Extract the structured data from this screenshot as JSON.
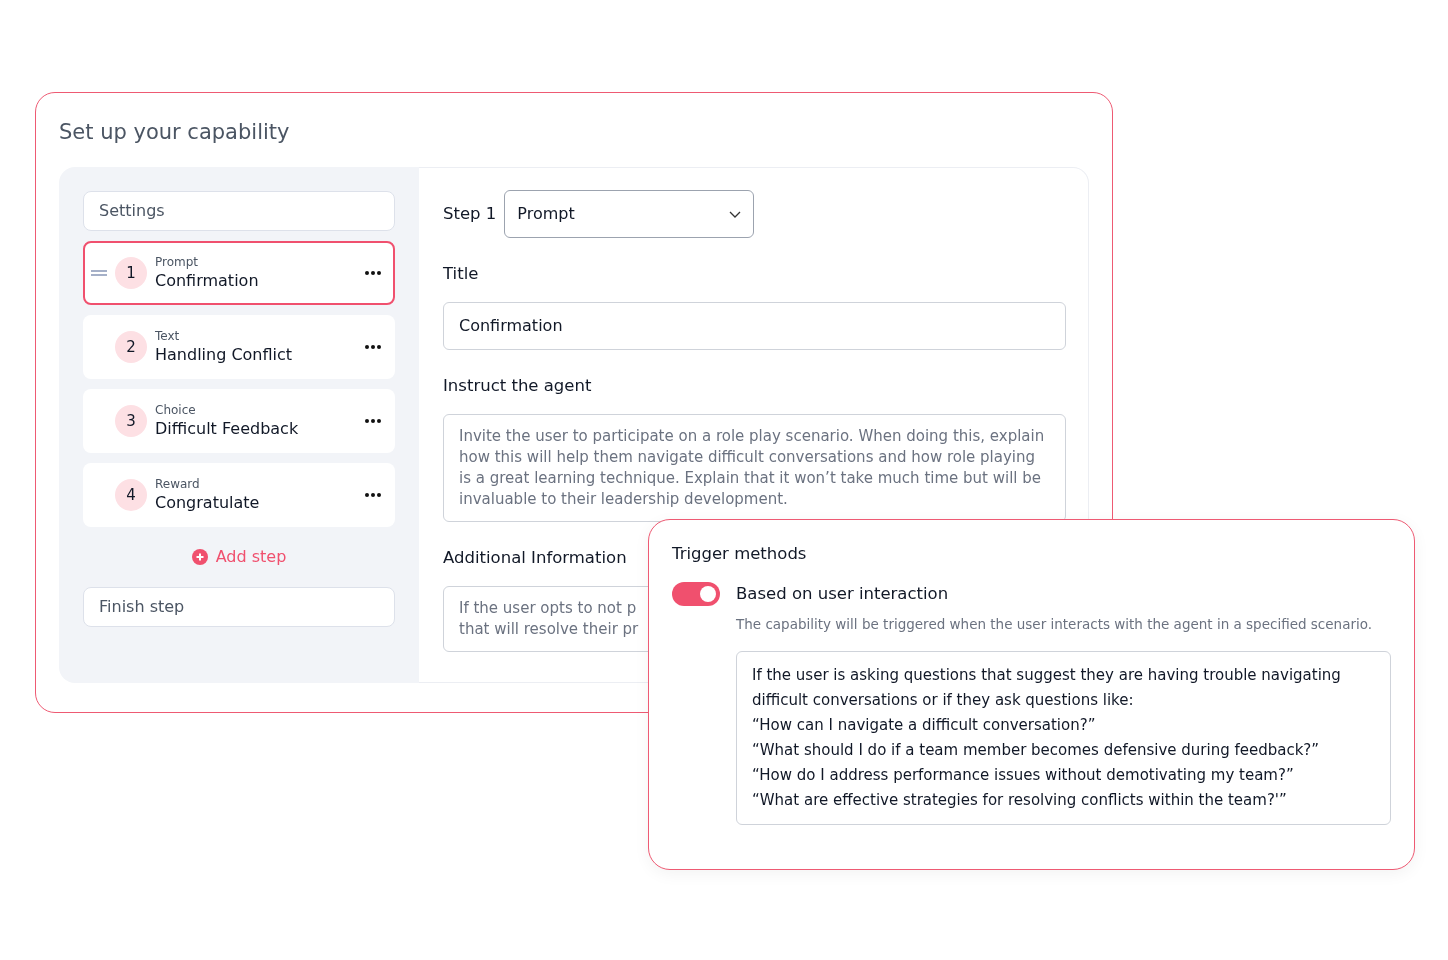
{
  "heading": "Set up your capability",
  "sidebar": {
    "settings": "Settings",
    "steps": [
      {
        "number": "1",
        "type": "Prompt",
        "title": "Confirmation",
        "selected": true
      },
      {
        "number": "2",
        "type": "Text",
        "title": "Handling Conflict",
        "selected": false
      },
      {
        "number": "3",
        "type": "Choice",
        "title": "Difficult Feedback",
        "selected": false
      },
      {
        "number": "4",
        "type": "Reward",
        "title": "Congratulate",
        "selected": false
      }
    ],
    "add_step": "Add step",
    "finish": "Finish step"
  },
  "editor": {
    "step_label": "Step 1",
    "step_type": "Prompt",
    "title_label": "Title",
    "title_value": "Confirmation",
    "instruct_label": "Instruct the agent",
    "instruct_value": "Invite the user to participate on a role play scenario. When doing this, explain how this will help them navigate difficult conversations and how role playing is a great learning technique. Explain that it won’t take much time but will be invaluable to their leadership development.",
    "additional_label": "Additional Information",
    "additional_lines": [
      "If the user opts to not p",
      "that will resolve their pr"
    ]
  },
  "trigger": {
    "title": "Trigger methods",
    "toggle": {
      "on": true,
      "label": "Based on user interaction"
    },
    "description": "The capability will be triggered when the user interacts with the agent in a specified scenario.",
    "scenario": "If the user is asking questions that suggest they are having trouble navigating difficult conversations or if they ask questions like:\n“How can I navigate a difficult conversation?”\n“What should I do if a team member becomes defensive during feedback?”\n“How do I address performance issues without demotivating my team?”\n“What are effective strategies for resolving conflicts within the team?'”"
  }
}
